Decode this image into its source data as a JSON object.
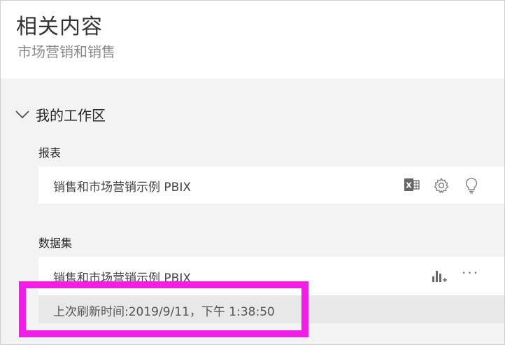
{
  "header": {
    "title": "相关内容",
    "subtitle": "市场营销和销售"
  },
  "workspace": {
    "label": "我的工作区"
  },
  "reports": {
    "section_label": "报表",
    "items": [
      {
        "title": "销售和市场营销示例 PBIX",
        "icons": [
          "excel-icon",
          "gear-icon",
          "lightbulb-icon"
        ]
      }
    ]
  },
  "datasets": {
    "section_label": "数据集",
    "items": [
      {
        "title": "销售和市场营销示例 PBIX",
        "icons": [
          "create-report-icon",
          "more-options-icon"
        ],
        "more_label": "···",
        "last_refresh": "上次刷新时间:2019/9/11，下午 1:38:50"
      }
    ]
  },
  "colors": {
    "highlight": "#f01fe6",
    "card_bg": "#ffffff",
    "panel_bg": "#f3f3f3"
  }
}
